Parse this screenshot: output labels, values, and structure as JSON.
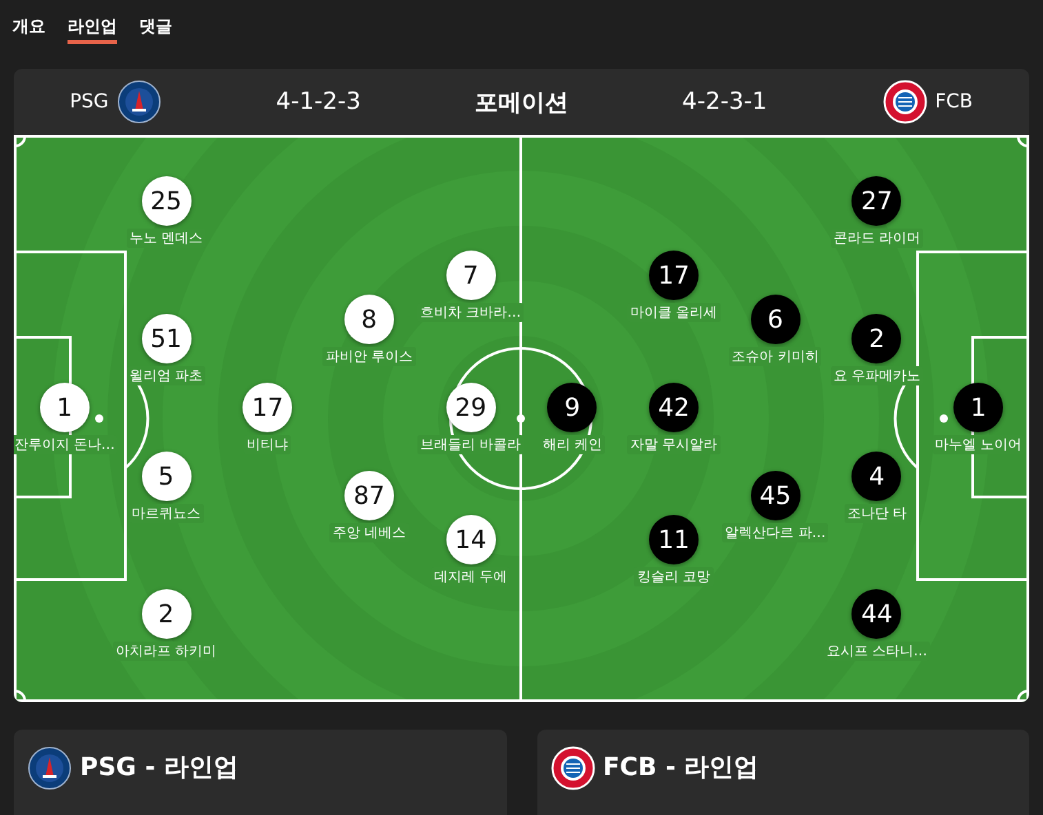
{
  "tabs": [
    {
      "label": "개요",
      "selected": false
    },
    {
      "label": "라인업",
      "selected": true
    },
    {
      "label": "댓글",
      "selected": false
    }
  ],
  "formation_header": {
    "title": "포메이션",
    "home": {
      "name": "PSG",
      "formation": "4-1-2-3"
    },
    "away": {
      "name": "FCB",
      "formation": "4-2-3-1"
    }
  },
  "pitch": {
    "teams": [
      {
        "color": "#ffffff",
        "lines": [
          [
            {
              "number": "1",
              "name": "잔루이지 돈나…"
            }
          ],
          [
            {
              "number": "25",
              "name": "누노 멘데스"
            },
            {
              "number": "51",
              "name": "윌리엄 파초"
            },
            {
              "number": "5",
              "name": "마르퀴뇨스"
            },
            {
              "number": "2",
              "name": "아치라프 하키미"
            }
          ],
          [
            {
              "number": "17",
              "name": "비티냐"
            }
          ],
          [
            {
              "number": "8",
              "name": "파비안 루이스"
            },
            {
              "number": "87",
              "name": "주앙 네베스"
            }
          ],
          [
            {
              "number": "7",
              "name": "흐비차 크바라…"
            },
            {
              "number": "29",
              "name": "브래들리 바콜라"
            },
            {
              "number": "14",
              "name": "데지레 두에"
            }
          ]
        ]
      },
      {
        "color": "#000000",
        "lines": [
          [
            {
              "number": "9",
              "name": "해리 케인"
            }
          ],
          [
            {
              "number": "17",
              "name": "마이클 올리세"
            },
            {
              "number": "42",
              "name": "자말 무시알라"
            },
            {
              "number": "11",
              "name": "킹슬리 코망"
            }
          ],
          [
            {
              "number": "6",
              "name": "조슈아 키미히"
            },
            {
              "number": "45",
              "name": "알렉산다르 파…"
            }
          ],
          [
            {
              "number": "27",
              "name": "콘라드 라이머"
            },
            {
              "number": "2",
              "name": "요 우파메카노"
            },
            {
              "number": "4",
              "name": "조나단 타"
            },
            {
              "number": "44",
              "name": "요시프 스타니…"
            }
          ],
          [
            {
              "number": "1",
              "name": "마누엘 노이어"
            }
          ]
        ]
      }
    ]
  },
  "lineup_cards": [
    {
      "kind": "home",
      "title": "PSG - 라인업"
    },
    {
      "kind": "away",
      "title": "FCB - 라인업"
    }
  ]
}
